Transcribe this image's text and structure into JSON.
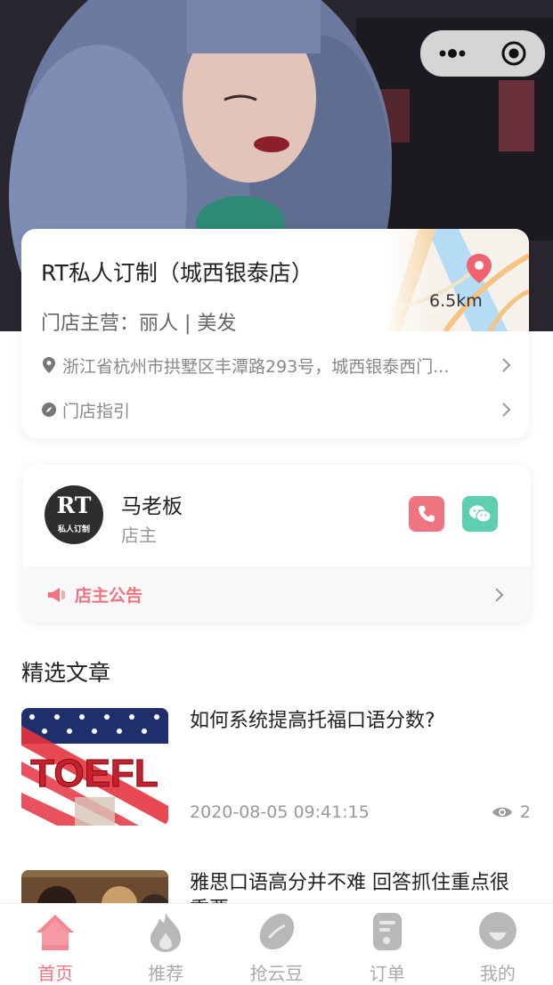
{
  "store": {
    "name": "RT私人订制（城西银泰店）",
    "main_business": "门店主营：丽人 | 美发",
    "distance": "6.5km",
    "address": "浙江省杭州市拱墅区丰潭路293号，城西银泰西门...",
    "guide_label": "门店指引"
  },
  "owner": {
    "avatar_text": "RT",
    "avatar_subtext": "私人订制",
    "name": "马老板",
    "role": "店主",
    "notice_label": "店主公告"
  },
  "articles_section": {
    "title": "精选文章"
  },
  "articles": [
    {
      "title": "如何系统提高托福口语分数?",
      "date": "2020-08-05 09:41:15",
      "views": "2",
      "thumb_text": "TOEFL"
    },
    {
      "title": "雅思口语高分并不难 回答抓住重点很重要"
    }
  ],
  "tabbar": [
    {
      "label": "首页",
      "icon": "home-icon",
      "active": true
    },
    {
      "label": "推荐",
      "icon": "flame-icon"
    },
    {
      "label": "抢云豆",
      "icon": "bean-icon"
    },
    {
      "label": "订单",
      "icon": "order-icon"
    },
    {
      "label": "我的",
      "icon": "profile-icon"
    }
  ],
  "colors": {
    "accent": "#f07380",
    "phone_button": "#f07380",
    "wechat_button": "#5ecfb1"
  }
}
